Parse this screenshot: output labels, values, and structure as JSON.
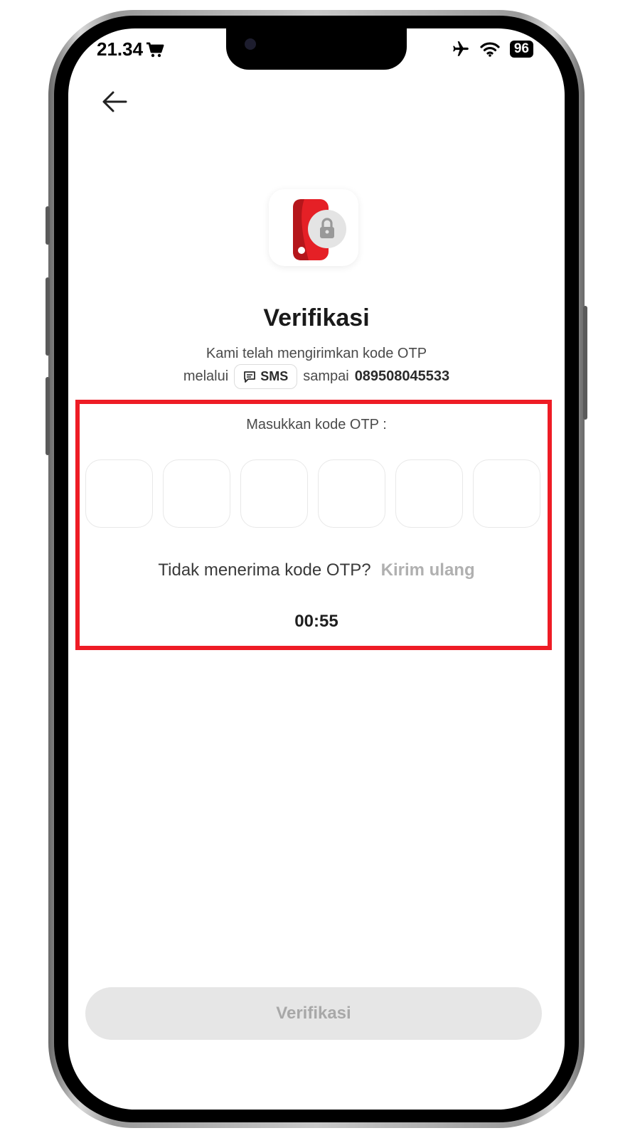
{
  "status_bar": {
    "time": "21.34",
    "battery": "96"
  },
  "header": {
    "title": "Verifikasi"
  },
  "description": {
    "line1": "Kami telah mengirimkan kode OTP",
    "via_prefix": "melalui",
    "channel": "SMS",
    "to_prefix": "sampai",
    "phone_number": "089508045533"
  },
  "otp": {
    "label": "Masukkan kode OTP :",
    "digits": [
      "",
      "",
      "",
      "",
      "",
      ""
    ],
    "resend_question": "Tidak menerima kode OTP?",
    "resend_link": "Kirim ulang",
    "timer": "00:55"
  },
  "actions": {
    "verify_label": "Verifikasi"
  },
  "colors": {
    "accent": "#ee1c25",
    "disabled_bg": "#e6e6e6",
    "disabled_text": "#a8a8a8"
  },
  "icons": [
    "back-arrow-icon",
    "cart-icon",
    "airplane-icon",
    "wifi-icon",
    "battery-icon",
    "phone-lock-icon",
    "chat-icon"
  ]
}
